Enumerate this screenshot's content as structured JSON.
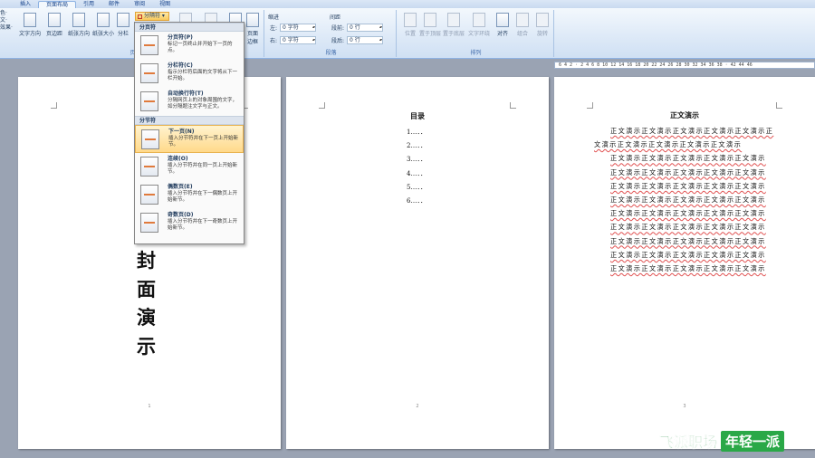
{
  "tabs": [
    {
      "label": "插入"
    },
    {
      "label": "页面布局"
    },
    {
      "label": "引用"
    },
    {
      "label": "邮件"
    },
    {
      "label": "审阅"
    },
    {
      "label": "视图"
    }
  ],
  "left_strip": [
    "色·",
    "文·",
    "效果·"
  ],
  "page_setup": {
    "buttons": [
      "文字方向",
      "页边距",
      "纸张方向",
      "纸张大小",
      "分栏"
    ],
    "breaks_button": "分隔符",
    "border_button": "页面\n边框",
    "group_label": "页面设置"
  },
  "indent": {
    "label": "缩进",
    "left_label": "左:",
    "left_value": "0 字符",
    "right_label": "右:",
    "right_value": "0 字符"
  },
  "spacing": {
    "label": "间距",
    "before_label": "段前:",
    "before_value": "0 行",
    "after_label": "段后:",
    "after_value": "0 行"
  },
  "paragraph_group_label": "段落",
  "arrange": {
    "buttons": [
      "位置",
      "置于顶层",
      "置于底层",
      "文字环绕",
      "对齐",
      "组合",
      "旋转"
    ],
    "group_label": "排列"
  },
  "ruler_text": "6 4 2 · 2 4 6 8 10 12 14 16 18 20 22 24 26 28 30 32 34 36 38 · 42 44 46",
  "breaks_menu": {
    "section1": "分页符",
    "items1": [
      {
        "title": "分页符(P)",
        "desc": "标记一页终止并开始下一页的点。"
      },
      {
        "title": "分栏符(C)",
        "desc": "指示分栏符后面的文字将从下一栏开始。"
      },
      {
        "title": "自动换行符(T)",
        "desc": "分隔网页上的对象周围的文字，如分隔题注文字与正文。"
      }
    ],
    "section2": "分节符",
    "items2": [
      {
        "title": "下一页(N)",
        "desc": "插入分节符并在下一页上开始新节。"
      },
      {
        "title": "连续(O)",
        "desc": "插入分节符并在同一页上开始新节。"
      },
      {
        "title": "偶数页(E)",
        "desc": "插入分节符并在下一偶数页上开始新节。"
      },
      {
        "title": "奇数页(D)",
        "desc": "插入分节符并在下一奇数页上开始新节。"
      }
    ]
  },
  "page1": {
    "cover": "封面演示",
    "num": "1"
  },
  "page2": {
    "title": "目录",
    "items": [
      "1…．．",
      "2…．．",
      "3…．．",
      "4…．．",
      "5…．．",
      "6…．．"
    ],
    "num": "2"
  },
  "page3": {
    "title": "正文演示",
    "paragraphs": [
      "正文演示正文演示正文演示正文演示正文演示正文演示正文演示正文演示正文演示正文演示",
      "正文演示正文演示正文演示正文演示正文演示",
      "正文演示正文演示正文演示正文演示正文演示",
      "正文演示正文演示正文演示正文演示正文演示",
      "正文演示正文演示正文演示正文演示正文演示",
      "正文演示正文演示正文演示正文演示正文演示",
      "正文演示正文演示正文演示正文演示正文演示",
      "正文演示正文演示正文演示正文演示正文演示",
      "正文演示正文演示正文演示正文演示正文演示",
      "正文演示正文演示正文演示正文演示正文演示"
    ],
    "num": "3"
  },
  "watermark": {
    "left": "飞派职场",
    "right": "年轻一派"
  }
}
